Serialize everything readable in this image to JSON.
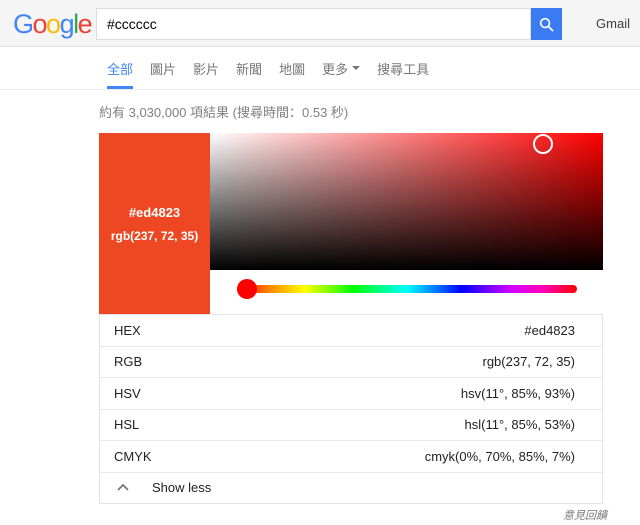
{
  "header": {
    "logo": {
      "letters": [
        {
          "ch": "G",
          "color": "#4285F4"
        },
        {
          "ch": "o",
          "color": "#EA4335"
        },
        {
          "ch": "o",
          "color": "#FBBC05"
        },
        {
          "ch": "g",
          "color": "#4285F4"
        },
        {
          "ch": "l",
          "color": "#34A853"
        },
        {
          "ch": "e",
          "color": "#EA4335"
        }
      ]
    },
    "search_value": "#cccccc",
    "gmail_label": "Gmail"
  },
  "tabs": {
    "items": [
      {
        "label": "全部",
        "active": true
      },
      {
        "label": "圖片",
        "active": false
      },
      {
        "label": "影片",
        "active": false
      },
      {
        "label": "新聞",
        "active": false
      },
      {
        "label": "地圖",
        "active": false
      },
      {
        "label": "更多",
        "active": false,
        "has_dropdown": true
      },
      {
        "label": "搜尋工具",
        "active": false
      }
    ]
  },
  "stats": {
    "text": "約有 3,030,000 項結果 (搜尋時間：0.53 秒)"
  },
  "color_picker": {
    "swatch": {
      "hex": "#ed4823",
      "rgb_label": "rgb(237, 72, 35)",
      "color": "#ed4823"
    },
    "hue_color": "#ff0000",
    "rows": [
      {
        "label": "HEX",
        "value": "#ed4823"
      },
      {
        "label": "RGB",
        "value": "rgb(237, 72, 35)"
      },
      {
        "label": "HSV",
        "value": "hsv(11°, 85%, 93%)"
      },
      {
        "label": "HSL",
        "value": "hsl(11°, 85%, 53%)"
      },
      {
        "label": "CMYK",
        "value": "cmyk(0%, 70%, 85%, 7%)"
      }
    ],
    "show_less_label": "Show less"
  },
  "feedback_label": "意見回饋",
  "colors": {
    "accent_blue": "#4285f4",
    "search_button_blue": "#3a7af3",
    "header_background": "#f5f5f5",
    "inactive_tab_gray": "#777777",
    "stats_gray": "#808080"
  },
  "icons": {
    "search_button": "magnifier-icon",
    "more_tab": "caret-down-icon",
    "show_less_row": "chevron-up-icon"
  }
}
